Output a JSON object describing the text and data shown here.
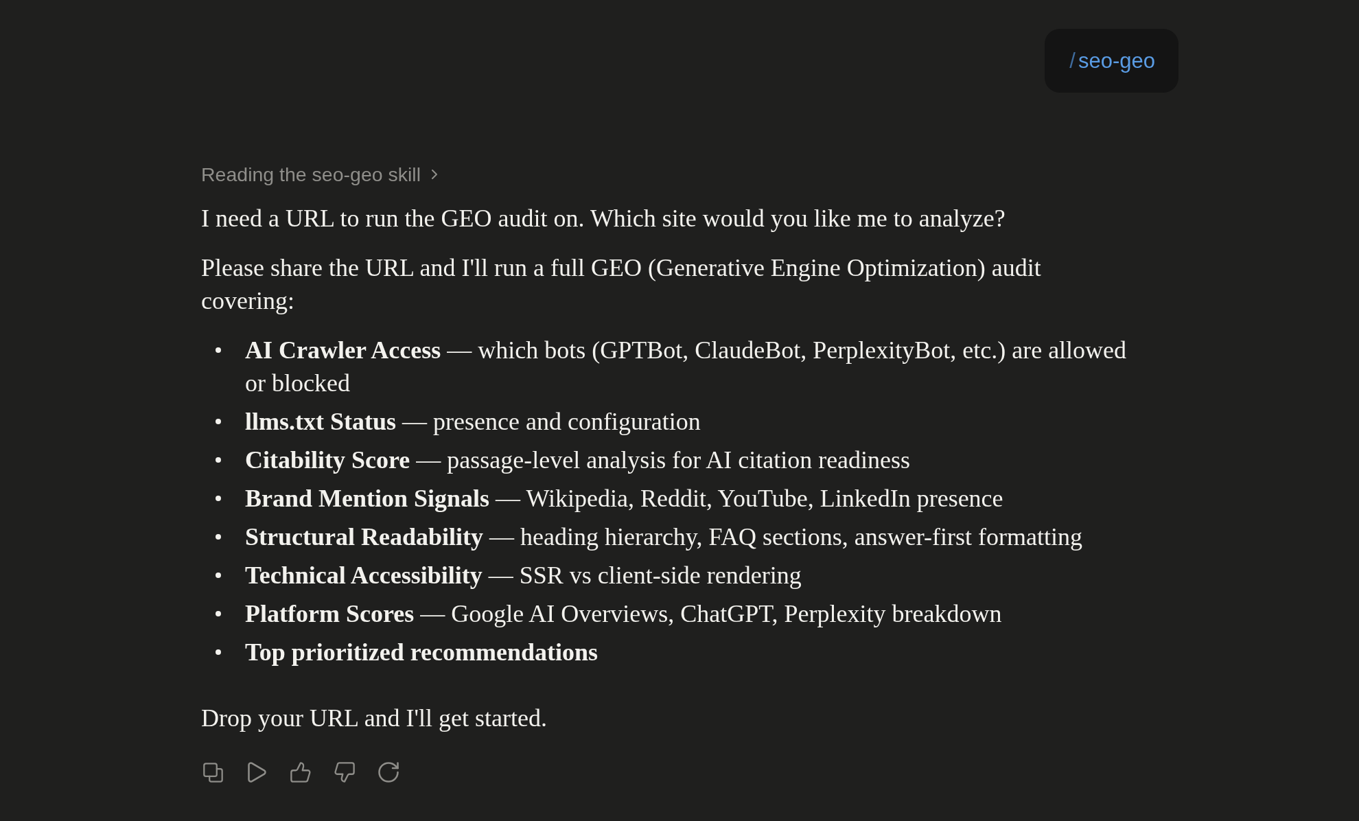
{
  "user_message": {
    "slash": "/",
    "command": "seo-geo"
  },
  "reasoning": {
    "label": "Reading the seo-geo skill",
    "expanded": false
  },
  "reply": {
    "paragraphs": [
      "I need a URL to run the GEO audit on. Which site would you like me to analyze?",
      "Please share the URL and I'll run a full GEO (Generative Engine Optimization) audit covering:"
    ],
    "bullets": [
      {
        "term": "AI Crawler Access",
        "detail": "— which bots (GPTBot, ClaudeBot, PerplexityBot, etc.) are allowed or blocked"
      },
      {
        "term": "llms.txt Status",
        "detail": "— presence and configuration"
      },
      {
        "term": "Citability Score",
        "detail": "— passage-level analysis for AI citation readiness"
      },
      {
        "term": "Brand Mention Signals",
        "detail": "— Wikipedia, Reddit, YouTube, LinkedIn presence"
      },
      {
        "term": "Structural Readability",
        "detail": "— heading hierarchy, FAQ sections, answer-first formatting"
      },
      {
        "term": "Technical Accessibility",
        "detail": "— SSR vs client-side rendering"
      },
      {
        "term": "Platform Scores",
        "detail": "— Google AI Overviews, ChatGPT, Perplexity breakdown"
      },
      {
        "term": "Top prioritized recommendations"
      }
    ],
    "closing": "Drop your URL and I'll get started."
  }
}
